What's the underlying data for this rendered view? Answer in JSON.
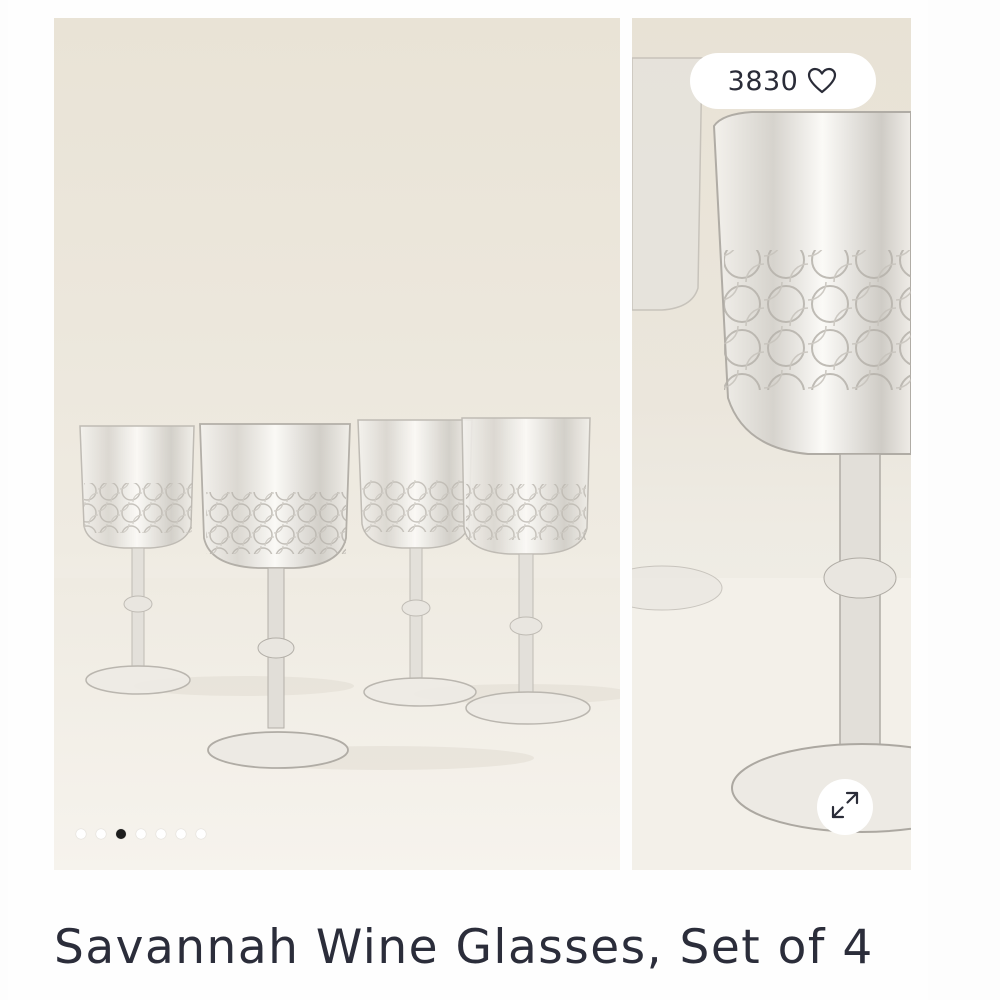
{
  "product": {
    "title": "Savannah Wine Glasses, Set of 4"
  },
  "gallery": {
    "like_count": "3830",
    "dot_count": 7,
    "active_dot": 3,
    "icons": {
      "like": "heart-outline-icon",
      "expand": "expand-arrows-icon"
    }
  },
  "colors": {
    "text": "#2b2d3a",
    "active_dot": "#1d1d1d",
    "inactive_dot": "#ffffff",
    "photo_background": "#ece7dc"
  }
}
